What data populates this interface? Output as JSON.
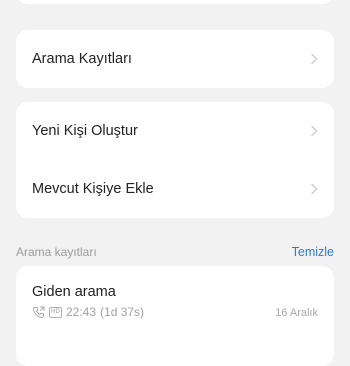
{
  "menu": {
    "call_logs": "Arama Kayıtları",
    "new_contact": "Yeni Kişi Oluştur",
    "add_existing": "Mevcut Kişiye Ekle"
  },
  "section": {
    "title": "Arama kayıtları",
    "clear_label": "Temizle"
  },
  "log": {
    "type": "Giden arama",
    "hd_badge": "HD",
    "time": "22:43",
    "duration": "(1d 37s)",
    "date": "16 Aralık"
  },
  "colors": {
    "accent": "#2f7bd8",
    "background": "#f2f2f2"
  }
}
